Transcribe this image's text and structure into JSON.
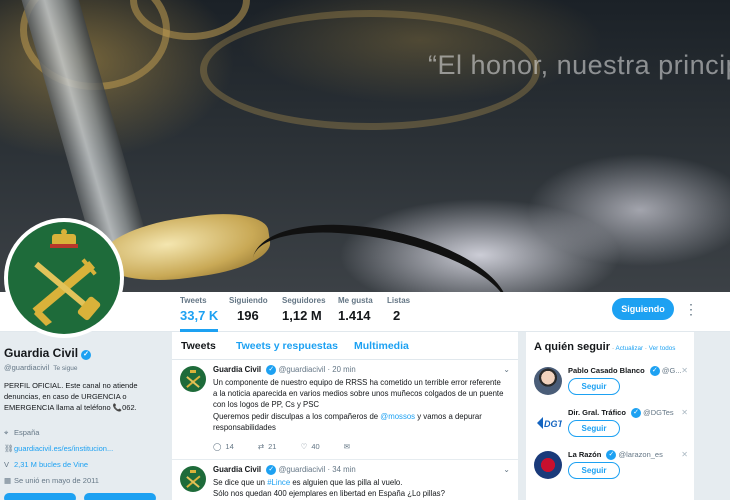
{
  "banner": {
    "motto": "“El honor, nuestra princip"
  },
  "nav": {
    "stats": [
      {
        "label": "Tweets",
        "value": "33,7 K"
      },
      {
        "label": "Siguiendo",
        "value": "196"
      },
      {
        "label": "Seguidores",
        "value": "1,12 M"
      },
      {
        "label": "Me gusta",
        "value": "1.414"
      },
      {
        "label": "Listas",
        "value": "2"
      }
    ],
    "following_label": "Siguiendo"
  },
  "profile": {
    "name": "Guardia Civil",
    "handle": "@guardiacivil",
    "follows_you": "Te sigue",
    "bio": "PERFIL OFICIAL. Este canal no atiende denuncias, en caso de URGENCIA o EMERGENCIA llama al teléfono 📞062.",
    "location": "España",
    "website": "guardiacivil.es/es/institucion...",
    "vine": "2,31 M bucles de Vine",
    "joined": "Se unió en mayo de 2011"
  },
  "timeline": {
    "tabs": [
      "Tweets",
      "Tweets y respuestas",
      "Multimedia"
    ],
    "tweets": [
      {
        "name": "Guardia Civil",
        "handle": "@guardiacivil",
        "time": "· 20 min",
        "text": "Un componente de nuestro equipo de RRSS ha cometido un terrible error referente a la noticia aparecida en varios medios sobre unos muñecos colgados de un puente con los logos de PP, Cs y PSC",
        "text2_pre": "Queremos pedir disculpas a los compañeros de ",
        "text2_link": "@mossos",
        "text2_post": " y vamos a depurar responsabilidades",
        "replies": "14",
        "retweets": "21",
        "likes": "40"
      },
      {
        "name": "Guardia Civil",
        "handle": "@guardiacivil",
        "time": "· 34 min",
        "text_pre": "Se dice que un ",
        "text_link": "#Lince",
        "text_post": " es alguien que las pilla al vuelo.",
        "text2": "Sólo nos quedan 400 ejemplares en libertad en España ¿Lo pillas?"
      }
    ]
  },
  "who_to_follow": {
    "title": "A quién seguir",
    "refresh": "Actualizar",
    "view_all": "Ver todos",
    "follow_label": "Seguir",
    "suggestions": [
      {
        "name": "Pablo Casado Blanco",
        "handle": "@G..."
      },
      {
        "name": "Dir. Gral. Tráfico",
        "handle": "@DGTes"
      },
      {
        "name": "La Razón",
        "handle": "@larazon_es"
      }
    ]
  },
  "colors": {
    "accent": "#1da1f2",
    "avatar_green": "#1e6b3a",
    "emblem_gold": "#d9b23a"
  }
}
